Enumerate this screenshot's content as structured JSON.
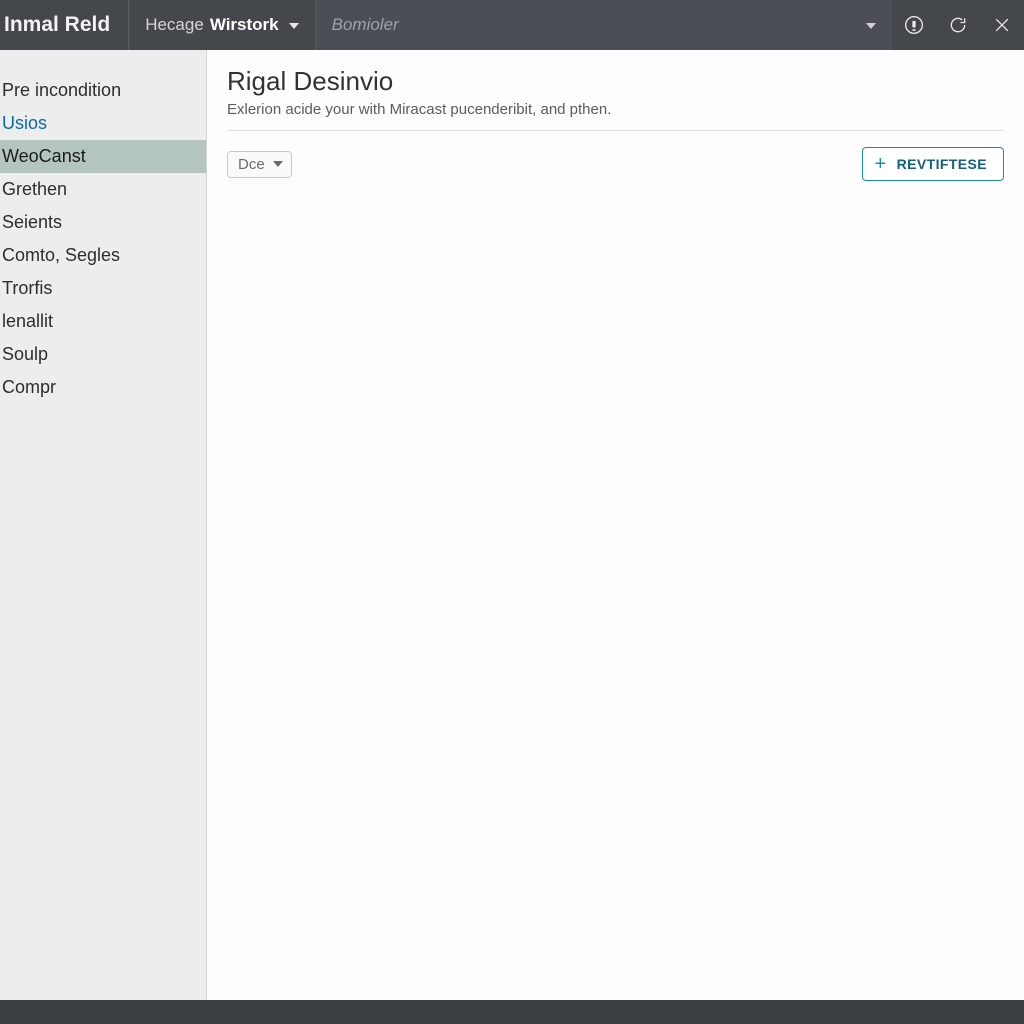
{
  "header": {
    "app_title": "Inmal Reld",
    "breadcrumb_prefix": "Hecage",
    "breadcrumb_current": "Wirstork",
    "search_placeholder": "Bomioler"
  },
  "sidebar": {
    "items": [
      {
        "label": "Pre incondition",
        "kind": "default"
      },
      {
        "label": "Usios",
        "kind": "link"
      },
      {
        "label": "WeoCanst",
        "kind": "selected"
      },
      {
        "label": "Grethen",
        "kind": "default"
      },
      {
        "label": "Seients",
        "kind": "default"
      },
      {
        "label": "Comto, Segles",
        "kind": "default"
      },
      {
        "label": "Trorfis",
        "kind": "default"
      },
      {
        "label": "lenallit",
        "kind": "default"
      },
      {
        "label": "Soulp",
        "kind": "default"
      },
      {
        "label": "Compr",
        "kind": "default"
      }
    ]
  },
  "main": {
    "title": "Rigal Desinvio",
    "subtitle": "Exlerion acide your with Miracast pucenderibit, and pthen.",
    "filter_label": "Dce",
    "primary_action_label": "REVTIFTESE"
  },
  "icons": {
    "notifications": "notifications-icon",
    "refresh": "refresh-icon",
    "close": "close-icon"
  },
  "colors": {
    "accent": "#1f8aa8",
    "topbar_bg": "#44484d",
    "sidebar_bg": "#ecedec",
    "selected_bg": "#b4c5c0",
    "link": "#0a6aa1"
  }
}
